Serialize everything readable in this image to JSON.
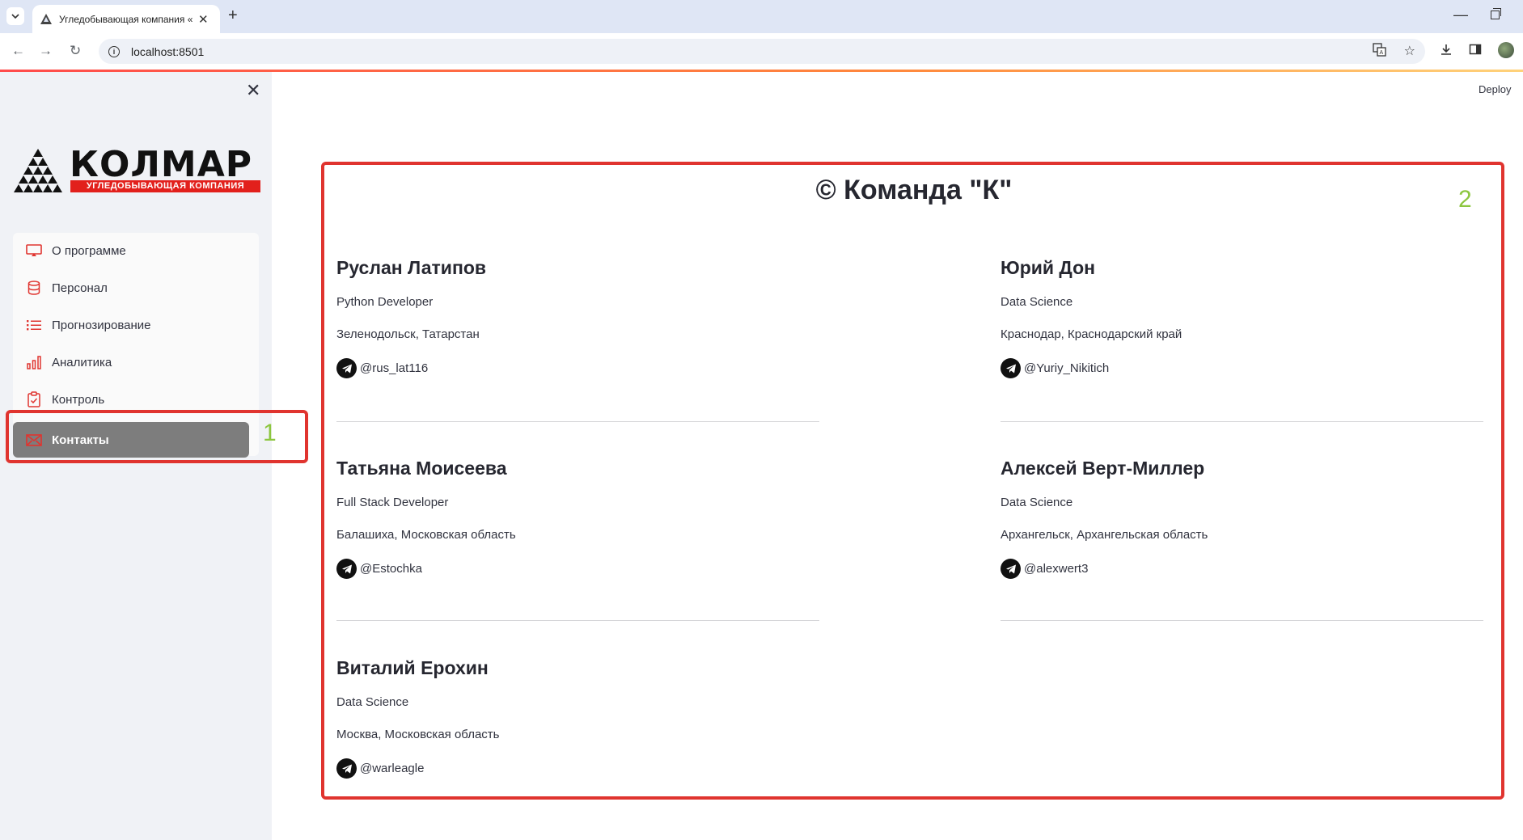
{
  "browser": {
    "tab_title": "Угледобывающая компания «Колмар»",
    "url": "localhost:8501"
  },
  "sidebar": {
    "logo_word": "КОЛМАР",
    "logo_subtitle": "УГЛЕДОБЫВАЮЩАЯ КОМПАНИЯ",
    "items": [
      {
        "label": "О программе",
        "icon": "monitor-icon"
      },
      {
        "label": "Персонал",
        "icon": "database-icon"
      },
      {
        "label": "Прогнозирование",
        "icon": "list-icon"
      },
      {
        "label": "Аналитика",
        "icon": "bar-chart-icon"
      },
      {
        "label": "Контроль",
        "icon": "clipboard-check-icon"
      },
      {
        "label": "Контакты",
        "icon": "envelope-icon",
        "active": true
      }
    ],
    "highlight_number": "1"
  },
  "header": {
    "deploy_label": "Deploy"
  },
  "main": {
    "title": "© Команда \"К\"",
    "highlight_number": "2",
    "contacts": [
      {
        "name": "Руслан Латипов",
        "role": "Python Developer",
        "city": "Зеленодольск, Татарстан",
        "telegram": "@rus_lat116"
      },
      {
        "name": "Юрий Дон",
        "role": "Data Science",
        "city": "Краснодар, Краснодарский край",
        "telegram": "@Yuriy_Nikitich"
      },
      {
        "name": "Татьяна Моисеева",
        "role": "Full Stack Developer",
        "city": "Балашиха, Московская область",
        "telegram": "@Estochka"
      },
      {
        "name": "Алексей Верт-Миллер",
        "role": "Data Science",
        "city": "Архангельск, Архангельская область",
        "telegram": "@alexwert3"
      },
      {
        "name": "Виталий Ерохин",
        "role": "Data Science",
        "city": "Москва, Московская область",
        "telegram": "@warleagle"
      }
    ]
  },
  "colors": {
    "accent_red": "#e0342f",
    "annotation_green": "#8cc63e",
    "active_menu_bg": "#7d7d7d"
  }
}
